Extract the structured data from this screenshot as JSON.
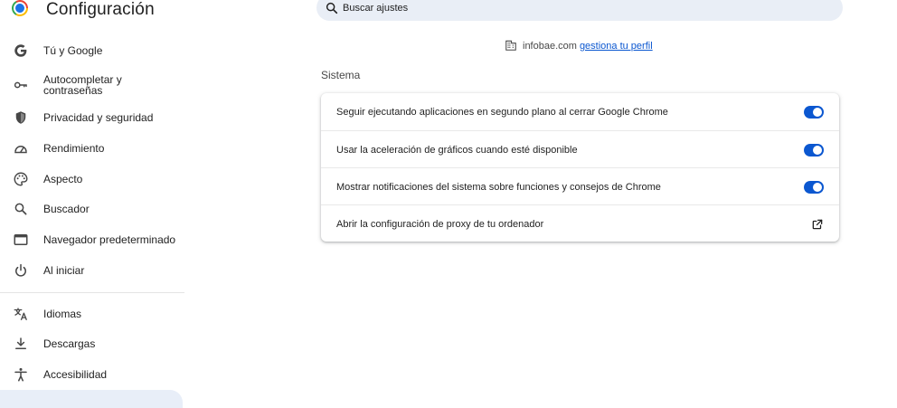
{
  "header": {
    "app_title": "Configuración",
    "search": {
      "placeholder": "Buscar ajustes",
      "icon": "search-icon"
    }
  },
  "sidebar": {
    "items": [
      {
        "label": "Tú y Google",
        "icon": "google-g-icon"
      },
      {
        "label": "Autocompletar y contraseñas",
        "icon": "key-icon"
      },
      {
        "label": "Privacidad y seguridad",
        "icon": "shield-icon"
      },
      {
        "label": "Rendimiento",
        "icon": "speedometer-icon"
      },
      {
        "label": "Aspecto",
        "icon": "palette-icon"
      },
      {
        "label": "Buscador",
        "icon": "search-icon"
      },
      {
        "label": "Navegador predeterminado",
        "icon": "browser-window-icon"
      },
      {
        "label": "Al iniciar",
        "icon": "power-icon"
      },
      {
        "label": "Idiomas",
        "icon": "translate-icon"
      },
      {
        "label": "Descargas",
        "icon": "download-icon"
      },
      {
        "label": "Accesibilidad",
        "icon": "accessibility-icon"
      }
    ]
  },
  "managed": {
    "domain": "infobae.com",
    "link": "gestiona tu perfil",
    "icon": "building-icon"
  },
  "section": {
    "title": "Sistema",
    "rows": [
      {
        "label": "Seguir ejecutando aplicaciones en segundo plano al cerrar Google Chrome",
        "control": "toggle",
        "checked": true
      },
      {
        "label": "Usar la aceleración de gráficos cuando esté disponible",
        "control": "toggle",
        "checked": true
      },
      {
        "label": "Mostrar notificaciones del sistema sobre funciones y consejos de Chrome",
        "control": "toggle",
        "checked": true
      },
      {
        "label": "Abrir la configuración de proxy de tu ordenador",
        "control": "external-link",
        "icon": "open-in-new-icon"
      }
    ]
  },
  "colors": {
    "accent": "#0b57d0",
    "search_bg": "#e9eef6",
    "selected_bg": "#e8eef8",
    "text": "#1f1f1f"
  }
}
